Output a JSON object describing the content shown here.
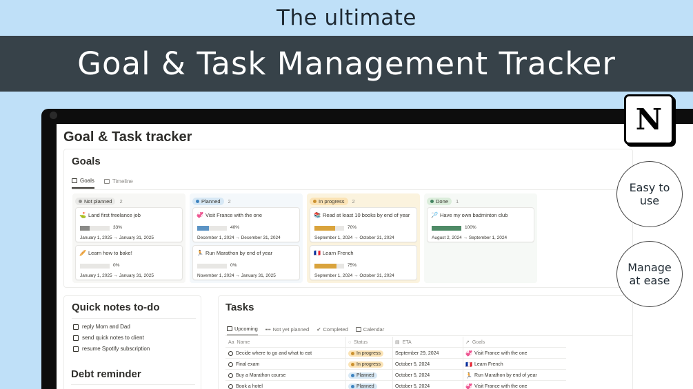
{
  "banner": {
    "subtitle": "The ultimate",
    "title": "Goal & Task Management Tracker"
  },
  "callouts": {
    "easy": "Easy to\nuse",
    "manage": "Manage\nat ease",
    "logo_letter": "N"
  },
  "page": {
    "title": "Goal & Task tracker"
  },
  "goals": {
    "heading": "Goals",
    "tabs": [
      {
        "label": "Goals",
        "icon": "board-icon"
      },
      {
        "label": "Timeline",
        "icon": "timeline-icon"
      }
    ],
    "columns": [
      {
        "label": "Not planned",
        "count": "2",
        "bg": "#f7f7f5",
        "pill_bg": "#e9e9e7",
        "dot": "#91918e",
        "bar": "#8a8a87",
        "cards": [
          {
            "emoji": "⛳",
            "title": "Land first freelance job",
            "progress": 0.33,
            "pct": "33%",
            "dates": "January 1, 2025 → January 31, 2025"
          },
          {
            "emoji": "🥖",
            "title": "Learn how to bake!",
            "progress": 0,
            "pct": "0%",
            "dates": "January 1, 2025 → January 31, 2025"
          }
        ]
      },
      {
        "label": "Planned",
        "count": "2",
        "bg": "#f4f8fb",
        "pill_bg": "#d7e8f5",
        "dot": "#3e84c0",
        "bar": "#5b93c4",
        "cards": [
          {
            "emoji": "💞",
            "title": "Visit France with the one",
            "progress": 0.4,
            "pct": "40%",
            "dates": "December 1, 2024 → December 31, 2024"
          },
          {
            "emoji": "🏃",
            "title": "Run Marathon by end of year",
            "progress": 0,
            "pct": "0%",
            "dates": "November 1, 2024 → January 31, 2025"
          }
        ]
      },
      {
        "label": "In progress",
        "count": "2",
        "bg": "#fbf3de",
        "pill_bg": "#fbe3b5",
        "dot": "#cb912f",
        "bar": "#d9a33c",
        "cards": [
          {
            "emoji": "📚",
            "title": "Read at least 10 books by end of year",
            "progress": 0.7,
            "pct": "70%",
            "dates": "September 1, 2024 → October 31, 2024"
          },
          {
            "emoji": "🇫🇷",
            "title": "Learn French",
            "progress": 0.75,
            "pct": "75%",
            "dates": "September 1, 2024 → October 31, 2024"
          }
        ]
      },
      {
        "label": "Done",
        "count": "1",
        "bg": "#f6f9f6",
        "pill_bg": "#dbeddb",
        "dot": "#448361",
        "bar": "#4e8a66",
        "cards": [
          {
            "emoji": "🏸",
            "title": "Have my own badminton club",
            "progress": 1,
            "pct": "100%",
            "dates": "August 2, 2024 → September 1, 2024"
          }
        ]
      }
    ]
  },
  "notes": {
    "heading": "Quick notes to-do",
    "items": [
      "reply Mom and Dad",
      "send quick notes to client",
      "resume Spotify subscription"
    ],
    "debt_heading": "Debt reminder"
  },
  "tasks": {
    "heading": "Tasks",
    "tabs": [
      {
        "label": "Upcoming",
        "icon": "table-icon"
      },
      {
        "label": "Not yet planned",
        "icon": "ellipsis-icon"
      },
      {
        "label": "Completed",
        "icon": "check-circle-icon"
      },
      {
        "label": "Calendar",
        "icon": "calendar-icon"
      }
    ],
    "columns": {
      "name": "Name",
      "status": "Status",
      "eta": "ETA",
      "goals": "Goals"
    },
    "header_icons": {
      "name": "Aa",
      "status": "◌",
      "eta": "▤",
      "goals": "↗"
    },
    "rows": [
      {
        "name": "Decide where to go and what to eat",
        "status": "In progress",
        "eta": "September 29, 2024",
        "goal_emoji": "💞",
        "goal": "Visit France with the one"
      },
      {
        "name": "Final exam",
        "status": "In progress",
        "eta": "October 5, 2024",
        "goal_emoji": "🇫🇷",
        "goal": "Learn French"
      },
      {
        "name": "Buy a Marathon course",
        "status": "Planned",
        "eta": "October 5, 2024",
        "goal_emoji": "🏃",
        "goal": "Run Marathon by end of year"
      },
      {
        "name": "Book a hotel",
        "status": "Planned",
        "eta": "October 5, 2024",
        "goal_emoji": "💞",
        "goal": "Visit France with the one"
      }
    ],
    "status_colors": {
      "In progress": {
        "bg": "#fbe3b5",
        "dot": "#cb912f"
      },
      "Planned": {
        "bg": "#d7e8f5",
        "dot": "#3e84c0"
      }
    }
  }
}
